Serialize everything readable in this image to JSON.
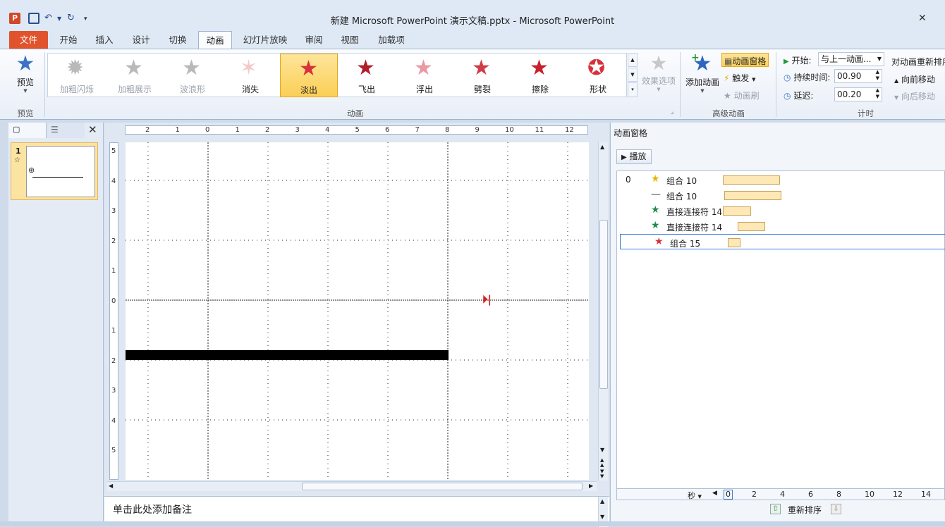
{
  "window": {
    "title": "新建 Microsoft PowerPoint 演示文稿.pptx - Microsoft PowerPoint",
    "close_glyph": "✕"
  },
  "qat": {
    "app_icon": "P",
    "save_icon": "save-icon",
    "undo_icon": "undo-icon",
    "redo_icon": "redo-icon"
  },
  "tabs": [
    "文件",
    "开始",
    "插入",
    "设计",
    "切换",
    "动画",
    "幻灯片放映",
    "审阅",
    "视图",
    "加载项"
  ],
  "ribbon": {
    "preview": {
      "label": "预览",
      "group": "预览"
    },
    "gallery_group": "动画",
    "effects": [
      {
        "label": "加粗闪烁",
        "color": "#b9b9b9",
        "disabled": true
      },
      {
        "label": "加粗展示",
        "color": "#b9b9b9",
        "disabled": true
      },
      {
        "label": "波浪形",
        "color": "#b9b9b9",
        "disabled": true
      },
      {
        "label": "消失",
        "color": "#f3c9c9",
        "disabled": false
      },
      {
        "label": "淡出",
        "color": "#d8313c",
        "disabled": false,
        "selected": true
      },
      {
        "label": "飞出",
        "color": "#b21d2a",
        "disabled": false
      },
      {
        "label": "浮出",
        "color": "#e89aa3",
        "disabled": false
      },
      {
        "label": "劈裂",
        "color": "#cf3d48",
        "disabled": false
      },
      {
        "label": "擦除",
        "color": "#c8202c",
        "disabled": false
      },
      {
        "label": "形状",
        "color": "#d8313c",
        "disabled": false
      }
    ],
    "effect_options": "效果选项",
    "advanced": {
      "group": "高级动画",
      "add": "添加动画",
      "pane": "动画窗格",
      "trigger": "触发",
      "painter": "动画刷"
    },
    "timing": {
      "group": "计时",
      "start_label": "开始:",
      "start_value": "与上一动画...",
      "duration_label": "持续时间:",
      "duration_value": "00.90",
      "delay_label": "延迟:",
      "delay_value": "00.20"
    },
    "reorder": {
      "title": "对动画重新排序",
      "forward": "向前移动",
      "backward": "向后移动"
    }
  },
  "slides": [
    {
      "number": "1",
      "anim_marker": "☆"
    }
  ],
  "ruler": {
    "h_ticks": [
      "2",
      "1",
      "0",
      "1",
      "2",
      "3",
      "4",
      "5",
      "6",
      "7",
      "8",
      "9",
      "10",
      "11",
      "12"
    ],
    "v_ticks": [
      "5",
      "4",
      "3",
      "2",
      "1",
      "0",
      "1",
      "2",
      "3",
      "4",
      "5"
    ]
  },
  "notes": {
    "placeholder": "单击此处添加备注"
  },
  "anim_pane": {
    "title": "动画窗格",
    "play": "播放",
    "items": [
      {
        "index": "0",
        "name": "组合",
        "num": "10",
        "icon_color": "#e6b800",
        "start": 0.0,
        "len": 0.45
      },
      {
        "index": "",
        "name": "组合",
        "num": "10",
        "icon_color": "#444444",
        "start": 0.02,
        "len": 0.45
      },
      {
        "index": "",
        "name": "直接连接符",
        "num": "14",
        "icon_color": "#1e8a4a",
        "start": 0.0,
        "len": 0.22
      },
      {
        "index": "",
        "name": "直接连接符",
        "num": "14",
        "icon_color": "#1e8a4a",
        "start": 0.26,
        "len": 0.22
      },
      {
        "index": "",
        "name": "组合",
        "num": "15",
        "icon_color": "#d8313c",
        "start": 0.02,
        "len": 0.1
      }
    ],
    "timeline": {
      "unit": "秒",
      "ticks": [
        "0",
        "2",
        "4",
        "6",
        "8",
        "10",
        "12",
        "14"
      ]
    },
    "reorder": "重新排序"
  }
}
